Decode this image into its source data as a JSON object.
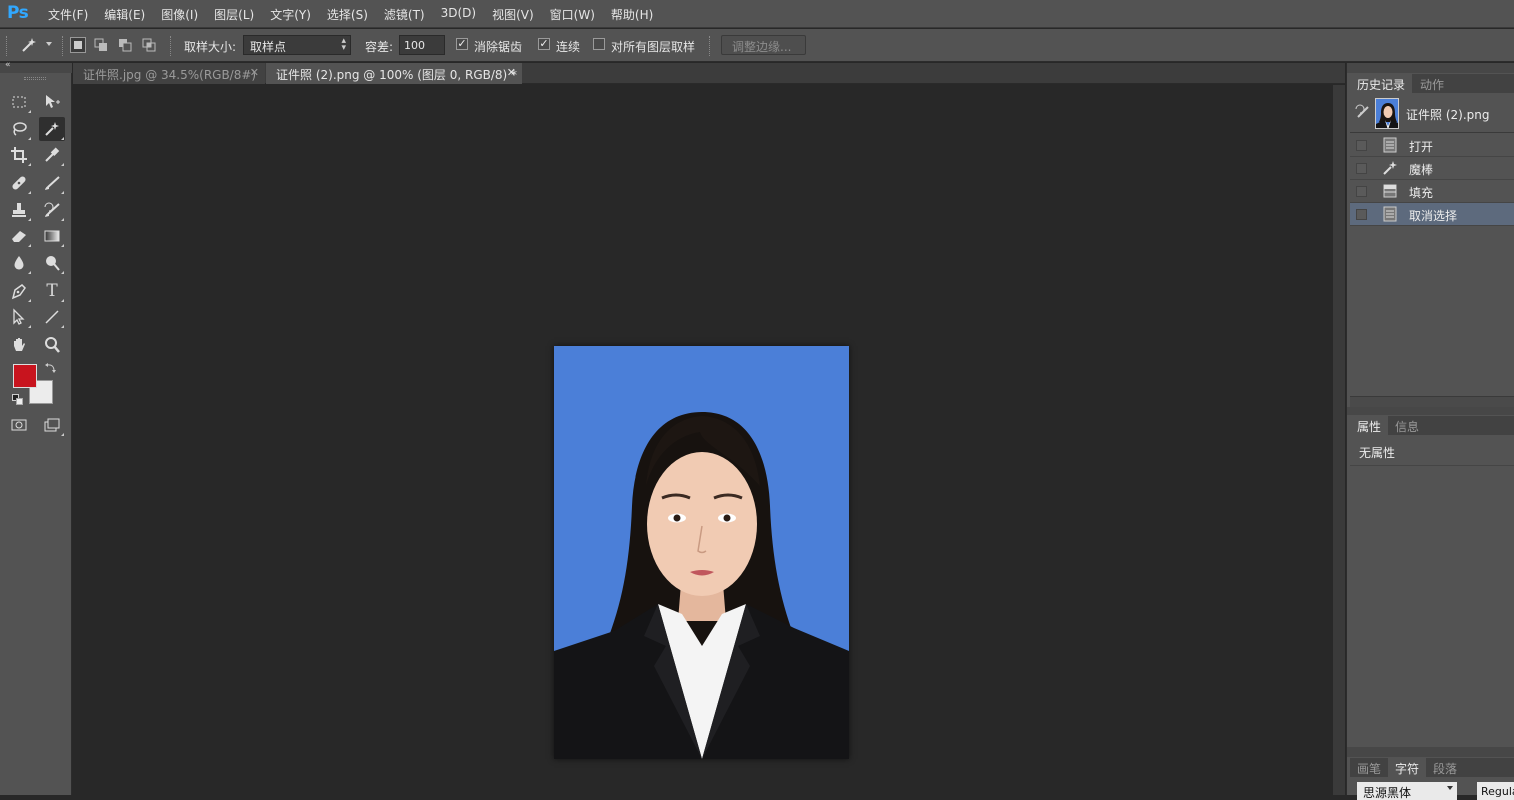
{
  "app": {
    "logo": "Ps",
    "menus": [
      "文件(F)",
      "编辑(E)",
      "图像(I)",
      "图层(L)",
      "文字(Y)",
      "选择(S)",
      "滤镜(T)",
      "3D(D)",
      "视图(V)",
      "窗口(W)",
      "帮助(H)"
    ]
  },
  "options": {
    "sample_size_label": "取样大小:",
    "sample_size_value": "取样点",
    "tolerance_label": "容差:",
    "tolerance_value": "100",
    "antialias_label": "消除锯齿",
    "antialias_checked": true,
    "contiguous_label": "连续",
    "contiguous_checked": true,
    "sample_all_label": "对所有图层取样",
    "sample_all_checked": false,
    "refine_edge_label": "调整边缘..."
  },
  "tabs": [
    {
      "label": "证件照.jpg @ 34.5%(RGB/8#)",
      "active": false
    },
    {
      "label": "证件照 (2).png @ 100% (图层 0, RGB/8) *",
      "active": true
    }
  ],
  "colors": {
    "foreground": "#c8141e",
    "background": "#ececec",
    "canvas_bg": "#4b7fd8"
  },
  "history_panel": {
    "tabs": [
      "历史记录",
      "动作"
    ],
    "snapshot_label": "证件照 (2).png",
    "items": [
      {
        "label": "打开",
        "icon": "document-icon",
        "selected": false
      },
      {
        "label": "魔棒",
        "icon": "magic-wand-icon",
        "selected": false
      },
      {
        "label": "填充",
        "icon": "fill-icon",
        "selected": false
      },
      {
        "label": "取消选择",
        "icon": "document-icon",
        "selected": true
      }
    ]
  },
  "properties_panel": {
    "tabs": [
      "属性",
      "信息"
    ],
    "content": "无属性"
  },
  "character_panel": {
    "tabs": [
      "画笔",
      "字符",
      "段落"
    ],
    "font_family": "思源黑体",
    "font_style": "Regula"
  }
}
